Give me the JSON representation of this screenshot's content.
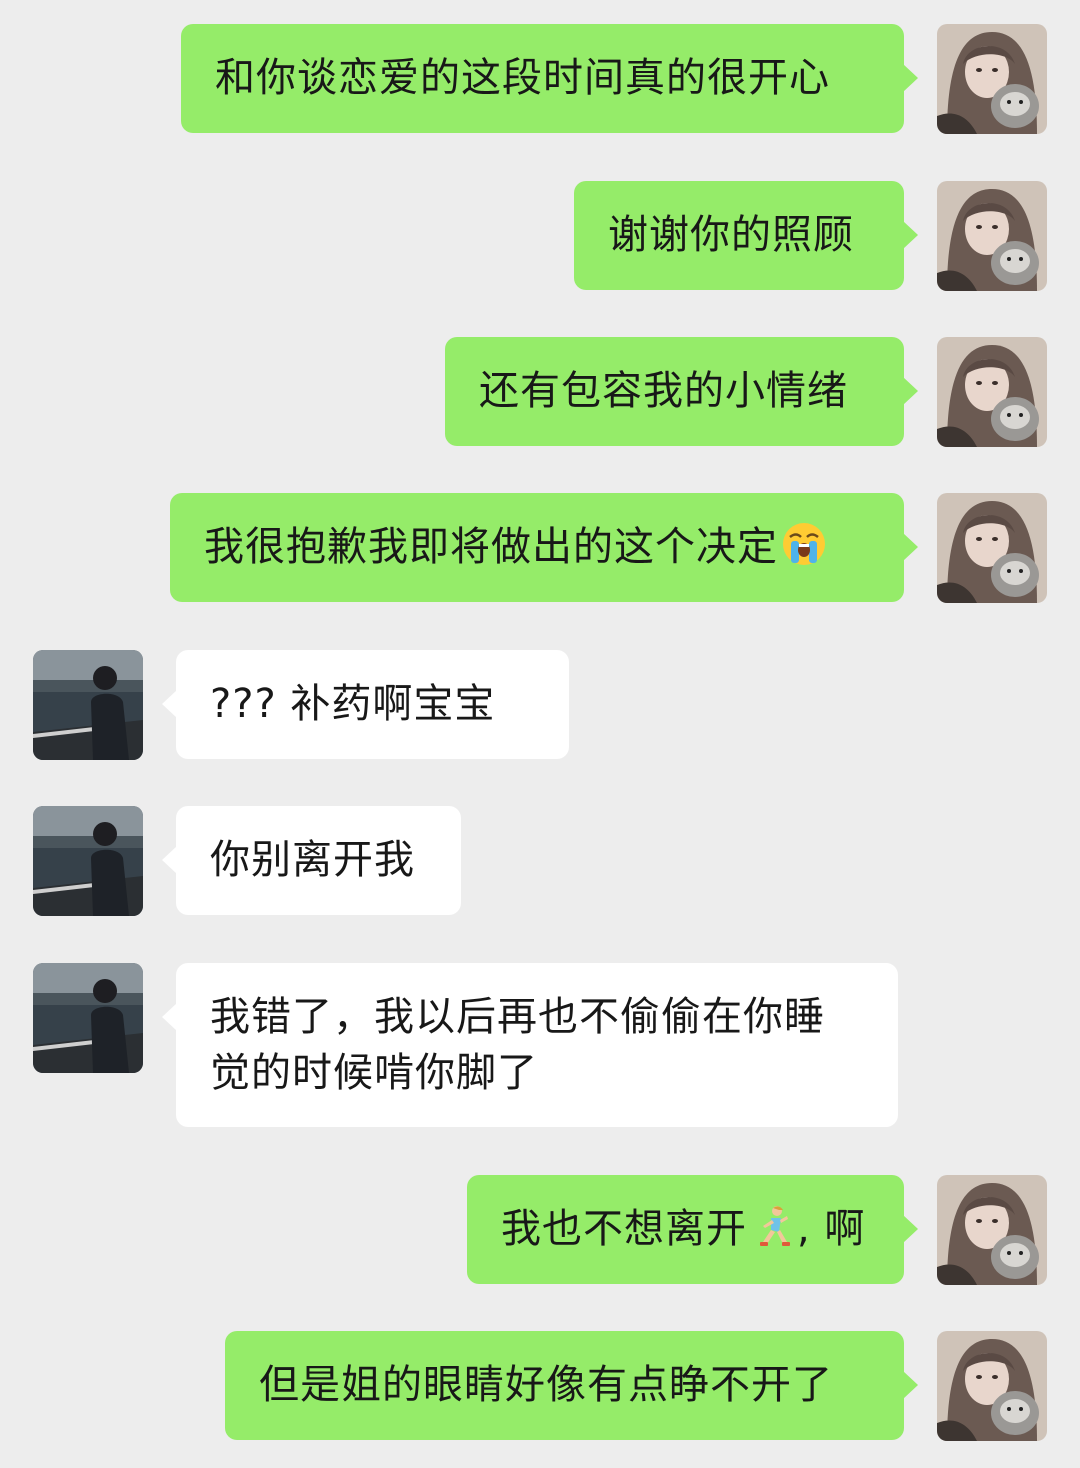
{
  "messages": [
    {
      "side": "me",
      "text": "和你谈恋爱的这段时间真的很开心"
    },
    {
      "side": "me",
      "text": "谢谢你的照顾"
    },
    {
      "side": "me",
      "text": "还有包容我的小情绪"
    },
    {
      "side": "me",
      "text": "我很抱歉我即将做出的这个决定",
      "emoji": "loudly-crying-face-icon"
    },
    {
      "side": "other",
      "text": "??? 补药啊宝宝"
    },
    {
      "side": "other",
      "text": "你别离开我"
    },
    {
      "side": "other",
      "text": "我错了，我以后再也不偷偷在你睡觉的时候啃你脚了"
    },
    {
      "side": "me",
      "text_before": "我也不想离开",
      "text_after": ", 啊",
      "emoji": "running-woman-icon"
    },
    {
      "side": "me",
      "text": "但是姐的眼睛好像有点睁不开了"
    }
  ],
  "colors": {
    "background": "#ededed",
    "my_bubble": "#95ec69",
    "other_bubble": "#ffffff"
  }
}
